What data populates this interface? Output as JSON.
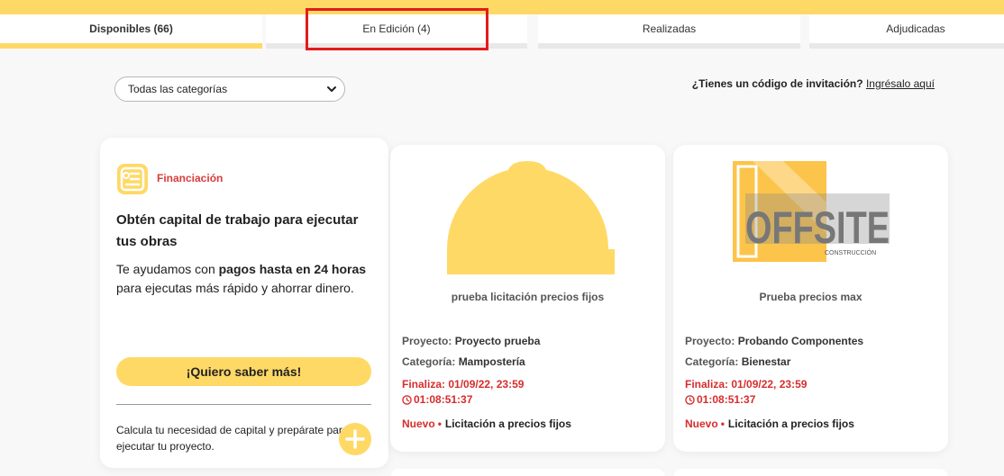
{
  "tabs": [
    {
      "label": "Disponibles (66)",
      "active": true
    },
    {
      "label": "En Edición (4)",
      "active": false
    },
    {
      "label": "Realizadas",
      "active": false
    },
    {
      "label": "Adjudicadas",
      "active": false
    }
  ],
  "filter": {
    "selected": "Todas las categorías"
  },
  "invite": {
    "question": "¿Tienes un código de invitación?",
    "link": "Ingrésalo aquí"
  },
  "financing": {
    "tag": "Financiación",
    "title": "Obtén capital de trabajo para ejecutar tus obras",
    "desc_before": "Te ayudamos con ",
    "desc_bold": "pagos hasta en 24 horas",
    "desc_after": " para ejecutas más rápido y ahorrar dinero.",
    "button": "¡Quiero saber más!",
    "calc": "Calcula tu necesidad de capital y prepárate para ejecutar tu proyecto."
  },
  "projects": [
    {
      "name": "prueba licitación precios fijos",
      "project_label": "Proyecto:",
      "project_value": "Proyecto prueba",
      "category_label": "Categoría:",
      "category_value": "Mampostería",
      "deadline": "Finaliza: 01/09/22, 23:59",
      "timer": "01:08:51:37",
      "status": "Nuevo",
      "type": "Licitación a precios fijos",
      "image": "helmet-placeholder"
    },
    {
      "name": "Prueba precios max",
      "project_label": "Proyecto:",
      "project_value": "Probando Componentes",
      "category_label": "Categoría:",
      "category_value": "Bienestar",
      "deadline": "Finaliza: 01/09/22, 23:59",
      "timer": "01:08:51:37",
      "status": "Nuevo",
      "type": "Licitación a precios fijos",
      "image": "offsite-logo",
      "logo_text": "OFFSITE",
      "logo_sub": "CONSTRUCCIÓN"
    }
  ],
  "colors": {
    "accent": "#ffd966",
    "alert": "#d62d2d",
    "highlight": "#e31b1b"
  }
}
